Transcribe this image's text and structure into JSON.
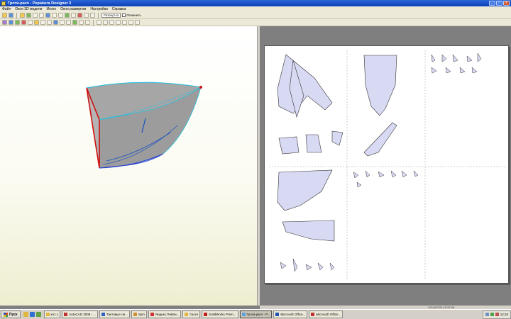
{
  "window": {
    "title": "Гроти-расч - Pepakura Designer 3"
  },
  "menu": [
    "Файл",
    "Окно 3D модели",
    "Иголо",
    "Окно развертки",
    "Настройки",
    "Справка"
  ],
  "toolbar": {
    "field_label": "Развертка",
    "checkbox_label": "Отменить"
  },
  "status": {
    "text": "2010/07/24 10:37:06"
  },
  "taskbar": {
    "start_label": "Пуск",
    "tasks": [
      {
        "label": "кп1.1",
        "color": "#e0b840"
      },
      {
        "label": "AutoCAD 2008 - ...",
        "color": "#c03030"
      },
      {
        "label": "Тактовые ли...",
        "color": "#3060c0"
      },
      {
        "label": "Spin",
        "color": "#d09030"
      },
      {
        "label": "Яндекс.Пейли...",
        "color": "#d03030"
      },
      {
        "label": "Гроти",
        "color": "#e0b840"
      },
      {
        "label": "SolidWorks Prem...",
        "color": "#c02020"
      },
      {
        "label": "Гроти-расч - P...",
        "color": "#60a0e0",
        "active": true
      },
      {
        "label": "Microsoft Office...",
        "color": "#2050b0"
      },
      {
        "label": "Microsoft Office...",
        "color": "#c03030"
      }
    ],
    "clock": "12:16"
  },
  "colors": {
    "accent": "#0a3fb5",
    "part_fill": "#d8daf4",
    "edge_red": "#d01010",
    "edge_cyan": "#20c0e0"
  }
}
